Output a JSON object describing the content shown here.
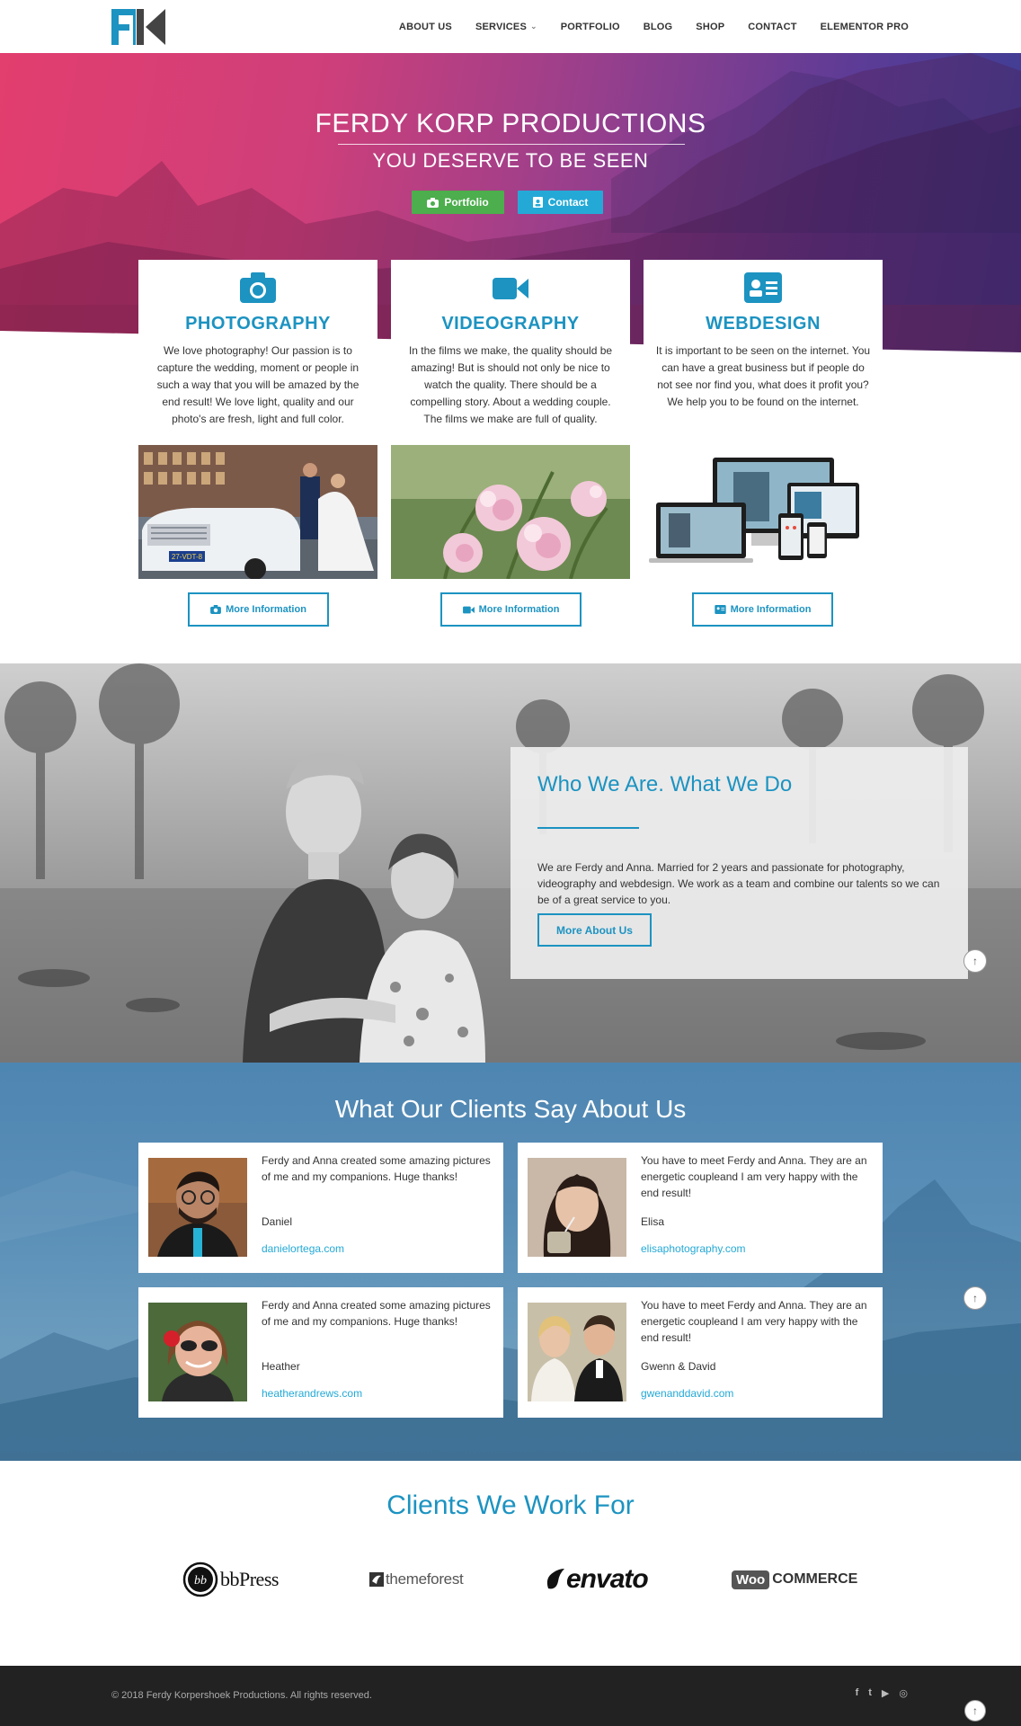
{
  "nav": {
    "items": [
      {
        "label": "ABOUT US"
      },
      {
        "label": "SERVICES",
        "chevron": "chevron-down-icon"
      },
      {
        "label": "PORTFOLIO"
      },
      {
        "label": "BLOG"
      },
      {
        "label": "SHOP"
      },
      {
        "label": "CONTACT"
      },
      {
        "label": "ELEMENTOR PRO"
      }
    ]
  },
  "hero": {
    "title": "FERDY KORP PRODUCTIONS",
    "subtitle": "YOU DESERVE TO BE SEEN",
    "buttons": [
      {
        "label": "Portfolio",
        "icon": "camera-icon",
        "color": "#4cae4c"
      },
      {
        "label": "Contact",
        "icon": "contact-card-icon",
        "color": "#24a9d6"
      }
    ]
  },
  "services": [
    {
      "title": "PHOTOGRAPHY",
      "icon": "camera-icon",
      "text": "We love photography! Our passion is to capture the wedding, moment or people in such a way that you will be amazed by the end result! We love light, quality and our photo's are fresh, light and full color.",
      "image": "wedding-couple-limousine-photo",
      "button": "More Information",
      "plate": "27-VDT-8"
    },
    {
      "title": "VIDEOGRAPHY",
      "icon": "video-camera-icon",
      "text": "In the films we make, the quality should be amazing! But is should not only be nice to watch the quality. There should be a compelling story. About a wedding couple. The films we make are full of quality.",
      "image": "pink-flowers-photo",
      "button": "More Information"
    },
    {
      "title": "WEBDESIGN",
      "icon": "id-card-icon",
      "text": "It is important to be seen on the internet. You can have a great business but if people do not see nor find you, what does it profit you? We help you to be found on the internet.",
      "image": "responsive-devices-mockup",
      "button": "More Information"
    }
  ],
  "about": {
    "title": "Who We Are. What We Do",
    "text": "We are Ferdy and Anna. Married for 2 years and passionate for photography, videography and webdesign. We work as a team and combine our talents so we can be of a great service to you.",
    "button": "More About Us"
  },
  "testimonials": {
    "title": "What Our Clients Say About Us",
    "items": [
      {
        "quote": "Ferdy and Anna created some amazing pictures of me and my companions. Huge thanks!",
        "name": "Daniel",
        "link": "danielortega.com"
      },
      {
        "quote": "You have to meet Ferdy and Anna. They are an energetic coupleand I am very happy with the end result!",
        "name": "Elisa",
        "link": "elisaphotography.com"
      },
      {
        "quote": "Ferdy and Anna created some amazing pictures of me and my companions. Huge thanks!",
        "name": "Heather",
        "link": "heatherandrews.com"
      },
      {
        "quote": "You have to meet Ferdy and Anna. They are an energetic coupleand I am very happy with the end result!",
        "name": "Gwenn & David",
        "link": "gwenanddavid.com"
      }
    ]
  },
  "clients": {
    "title": "Clients We Work For",
    "logos": [
      {
        "name": "bbpress-logo",
        "text": "bbPress",
        "mark": "bb"
      },
      {
        "name": "themeforest-logo",
        "text": "themeforest"
      },
      {
        "name": "envato-logo",
        "text": "envato"
      },
      {
        "name": "woocommerce-logo",
        "badge": "Woo",
        "text": "COMMERCE"
      }
    ]
  },
  "footer": {
    "copyright": "© 2018 Ferdy Korpershoek Productions. All rights reserved.",
    "social": [
      {
        "icon": "facebook-icon",
        "glyph": "f"
      },
      {
        "icon": "twitter-icon",
        "glyph": "t"
      },
      {
        "icon": "youtube-icon",
        "glyph": "▶"
      },
      {
        "icon": "instagram-icon",
        "glyph": "◎"
      }
    ]
  },
  "scroll_top_glyph": "↑",
  "colors": {
    "accent": "#1c93c1",
    "link": "#24a9d6",
    "portfolio_button": "#4cae4c",
    "contact_button": "#24a9d6",
    "footer": "#222222"
  }
}
